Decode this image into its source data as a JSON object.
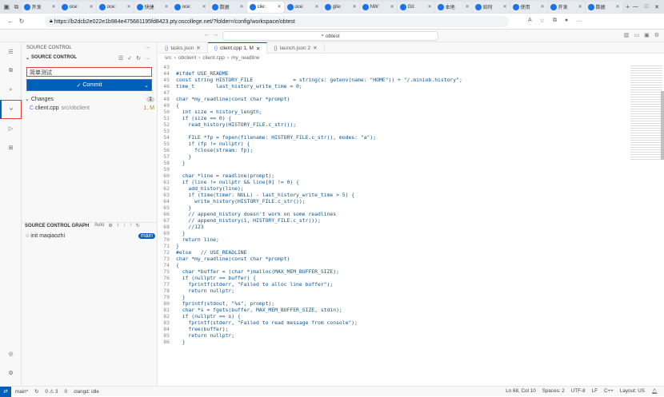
{
  "browser": {
    "tabs": [
      {
        "label": "开发",
        "active": false
      },
      {
        "label": "oce:",
        "active": false
      },
      {
        "label": "oce:",
        "active": false
      },
      {
        "label": "快捷",
        "active": false
      },
      {
        "label": "oce:",
        "active": false
      },
      {
        "label": "数据",
        "active": false
      },
      {
        "label": "clie:",
        "active": true
      },
      {
        "label": "oce:",
        "active": false
      },
      {
        "label": "gite:",
        "active": false
      },
      {
        "label": "NW:",
        "active": false
      },
      {
        "label": "Git:",
        "active": false
      },
      {
        "label": "本地",
        "active": false
      },
      {
        "label": "如何",
        "active": false
      },
      {
        "label": "使用",
        "active": false
      },
      {
        "label": "开发",
        "active": false
      },
      {
        "label": "数据",
        "active": false
      }
    ],
    "url": "https://b2dcb2e022e1b984e475681195fd8423.pty.oscollege.net/?folder=/config/workspace/obtest"
  },
  "vscode": {
    "command_center": "obtest",
    "source_control_header": "SOURCE CONTROL",
    "section_title": "SOURCE CONTROL",
    "commit_message": "简单测试",
    "commit_label": "Commit",
    "changes_label": "Changes",
    "changes_count": "1",
    "change_file": "client.cpp",
    "change_path": "src/obclient",
    "change_status": "1, M",
    "graph_title": "SOURCE CONTROL GRAPH",
    "graph_auto": "Auto",
    "graph_commit": "init",
    "graph_author": "maqiaozhi",
    "graph_branch": "main",
    "tabs": [
      {
        "label": "tasks.json",
        "active": false,
        "modified": false
      },
      {
        "label": "client.cpp 1, M",
        "active": true,
        "modified": true
      },
      {
        "label": "launch.json 2",
        "active": false,
        "modified": false
      }
    ],
    "breadcrumb": [
      "src",
      "obclient",
      "client.cpp",
      "my_readline"
    ],
    "code_lines": [
      {
        "n": "43",
        "t": ""
      },
      {
        "n": "44",
        "t": "#ifdef USE_README"
      },
      {
        "n": "45",
        "t": "const string HISTORY_FILE             = string(s: getenv(name: \"HOME\")) + \"/.miniob.history\";"
      },
      {
        "n": "46",
        "t": "time_t       last_history_write_time = 0;"
      },
      {
        "n": "47",
        "t": ""
      },
      {
        "n": "48",
        "t": "char *my_readline(const char *prompt)"
      },
      {
        "n": "49",
        "t": "{"
      },
      {
        "n": "50",
        "t": "  int size = history_length;"
      },
      {
        "n": "51",
        "t": "  if (size == 0) {"
      },
      {
        "n": "52",
        "t": "    read_history(HISTORY_FILE.c_str());"
      },
      {
        "n": "53",
        "t": ""
      },
      {
        "n": "54",
        "t": "    FILE *fp = fopen(filename: HISTORY_FILE.c_str(), modes: \"a\");"
      },
      {
        "n": "55",
        "t": "    if (fp != nullptr) {"
      },
      {
        "n": "56",
        "t": "      fclose(stream: fp);"
      },
      {
        "n": "57",
        "t": "    }"
      },
      {
        "n": "58",
        "t": "  }"
      },
      {
        "n": "59",
        "t": ""
      },
      {
        "n": "60",
        "t": "  char *line = readline(prompt);"
      },
      {
        "n": "61",
        "t": "  if (line != nullptr && line[0] != 0) {"
      },
      {
        "n": "62",
        "t": "    add_history(line);"
      },
      {
        "n": "63",
        "t": "    if (time(timer: NULL) - last_history_write_time > 5) {"
      },
      {
        "n": "64",
        "t": "      write_history(HISTORY_FILE.c_str());"
      },
      {
        "n": "65",
        "t": "    }"
      },
      {
        "n": "66",
        "t": "    // append_history doesn't work on some readlines"
      },
      {
        "n": "67",
        "t": "    // append_history(1, HISTORY_FILE.c_str());"
      },
      {
        "n": "68",
        "t": "    //123"
      },
      {
        "n": "69",
        "t": "  }"
      },
      {
        "n": "70",
        "t": "  return line;"
      },
      {
        "n": "71",
        "t": "}"
      },
      {
        "n": "72",
        "t": "#else   // USE_READLINE"
      },
      {
        "n": "73",
        "t": "char *my_readline(const char *prompt)"
      },
      {
        "n": "74",
        "t": "{"
      },
      {
        "n": "75",
        "t": "  char *buffer = (char *)malloc(MAX_MEM_BUFFER_SIZE);"
      },
      {
        "n": "76",
        "t": "  if (nullptr == buffer) {"
      },
      {
        "n": "77",
        "t": "    fprintf(stderr, \"Failed to alloc line buffer\");"
      },
      {
        "n": "78",
        "t": "    return nullptr;"
      },
      {
        "n": "79",
        "t": "  }"
      },
      {
        "n": "80",
        "t": "  fprintf(stdout, \"%s\", prompt);"
      },
      {
        "n": "81",
        "t": "  char *s = fgets(buffer, MAX_MEM_BUFFER_SIZE, stdin);"
      },
      {
        "n": "82",
        "t": "  if (nullptr == s) {"
      },
      {
        "n": "83",
        "t": "    fprintf(stderr, \"Failed to read message from console\");"
      },
      {
        "n": "84",
        "t": "    free(buffer);"
      },
      {
        "n": "85",
        "t": "    return nullptr;"
      },
      {
        "n": "86",
        "t": "  }"
      }
    ],
    "status": {
      "branch": "main*",
      "problems": "0 ⚠ 3",
      "ports": "0",
      "clangd": "clangd: idle",
      "position": "Ln 68, Col 10",
      "spaces": "Spaces: 2",
      "encoding": "UTF-8",
      "eol": "LF",
      "lang": "C++",
      "layout": "Layout: US"
    }
  }
}
